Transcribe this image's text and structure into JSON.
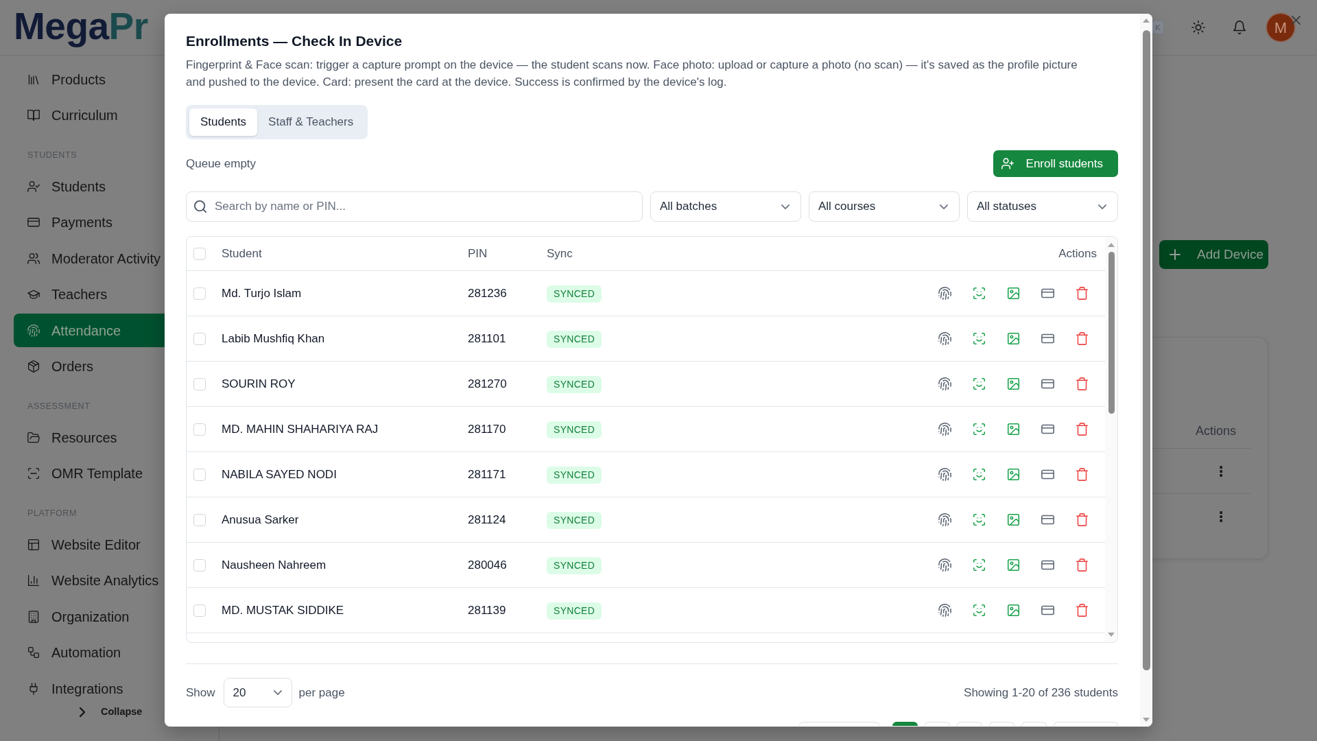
{
  "topbar": {
    "logo": [
      "Mega",
      "Pr"
    ],
    "shortcut_key": "K",
    "avatar_initial": "M"
  },
  "sidebar": {
    "groups": [
      {
        "items": [
          {
            "label": "Products",
            "selected": false
          },
          {
            "label": "Curriculum",
            "selected": false
          }
        ]
      },
      {
        "heading": "STUDENTS",
        "items": [
          {
            "label": "Students",
            "selected": false
          },
          {
            "label": "Payments",
            "selected": false
          },
          {
            "label": "Moderator Activity",
            "selected": false
          },
          {
            "label": "Teachers",
            "selected": false
          },
          {
            "label": "Attendance",
            "selected": true
          },
          {
            "label": "Orders",
            "selected": false
          }
        ]
      },
      {
        "heading": "ASSESSMENT",
        "items": [
          {
            "label": "Resources",
            "selected": false
          },
          {
            "label": "OMR Template",
            "selected": false
          }
        ]
      },
      {
        "heading": "PLATFORM",
        "items": [
          {
            "label": "Website Editor",
            "selected": false
          },
          {
            "label": "Website Analytics",
            "selected": false
          },
          {
            "label": "Organization",
            "selected": false
          },
          {
            "label": "Automation",
            "selected": false
          },
          {
            "label": "Integrations",
            "selected": false
          }
        ]
      }
    ],
    "collapse_label": "Collapse"
  },
  "main": {
    "add_button": "Add Device",
    "table": {
      "columns": [
        "Actions"
      ],
      "rows": [
        {
          "actions": "⋮"
        },
        {
          "actions": "⋮"
        }
      ]
    }
  },
  "dialog": {
    "title": "Enrollments — Check In Device",
    "description": "Fingerprint & Face scan: trigger a capture prompt on the device — the student scans now. Face photo: upload or capture a photo (no scan) — it's saved as the profile picture and pushed to the device. Card: present the card at the device. Success is confirmed by the device's log.",
    "tabs": [
      {
        "label": "Students",
        "selected": true
      },
      {
        "label": "Staff & Teachers",
        "selected": false
      }
    ],
    "queue_status": "Queue empty",
    "enroll_button": "Enroll students",
    "search": {
      "placeholder": "Search by name or PIN..."
    },
    "filters": [
      {
        "value": "All batches"
      },
      {
        "value": "All courses"
      },
      {
        "value": "All statuses"
      }
    ],
    "table": {
      "columns": [
        "Student",
        "PIN",
        "Sync",
        "Actions"
      ],
      "select_all": {
        "checked": false
      },
      "rows": [
        {
          "checked": false,
          "student": "Md. Turjo Islam",
          "pin": "281236",
          "sync": "SYNCED"
        },
        {
          "checked": false,
          "student": "Labib Mushfiq Khan",
          "pin": "281101",
          "sync": "SYNCED"
        },
        {
          "checked": false,
          "student": "SOURIN ROY",
          "pin": "281270",
          "sync": "SYNCED"
        },
        {
          "checked": false,
          "student": "MD. MAHIN SHAHARIYA RAJ",
          "pin": "281170",
          "sync": "SYNCED"
        },
        {
          "checked": false,
          "student": "NABILA SAYED NODI",
          "pin": "281171",
          "sync": "SYNCED"
        },
        {
          "checked": false,
          "student": "Anusua Sarker",
          "pin": "281124",
          "sync": "SYNCED"
        },
        {
          "checked": false,
          "student": "Nausheen Nahreem",
          "pin": "280046",
          "sync": "SYNCED"
        },
        {
          "checked": false,
          "student": "MD. MUSTAK SIDDIKE",
          "pin": "281139",
          "sync": "SYNCED"
        }
      ]
    },
    "pagination": {
      "show_label": "Show",
      "page_size": "20",
      "per_page_label": "per page",
      "summary": "Showing 1-20 of 236 students",
      "buttons": [
        {
          "kind": "previous",
          "selected": false
        },
        {
          "kind": "page",
          "selected": true
        },
        {
          "kind": "page",
          "selected": false
        },
        {
          "kind": "page",
          "selected": false
        },
        {
          "kind": "page",
          "selected": false
        },
        {
          "kind": "page",
          "selected": false
        },
        {
          "kind": "next",
          "selected": false
        }
      ]
    }
  }
}
